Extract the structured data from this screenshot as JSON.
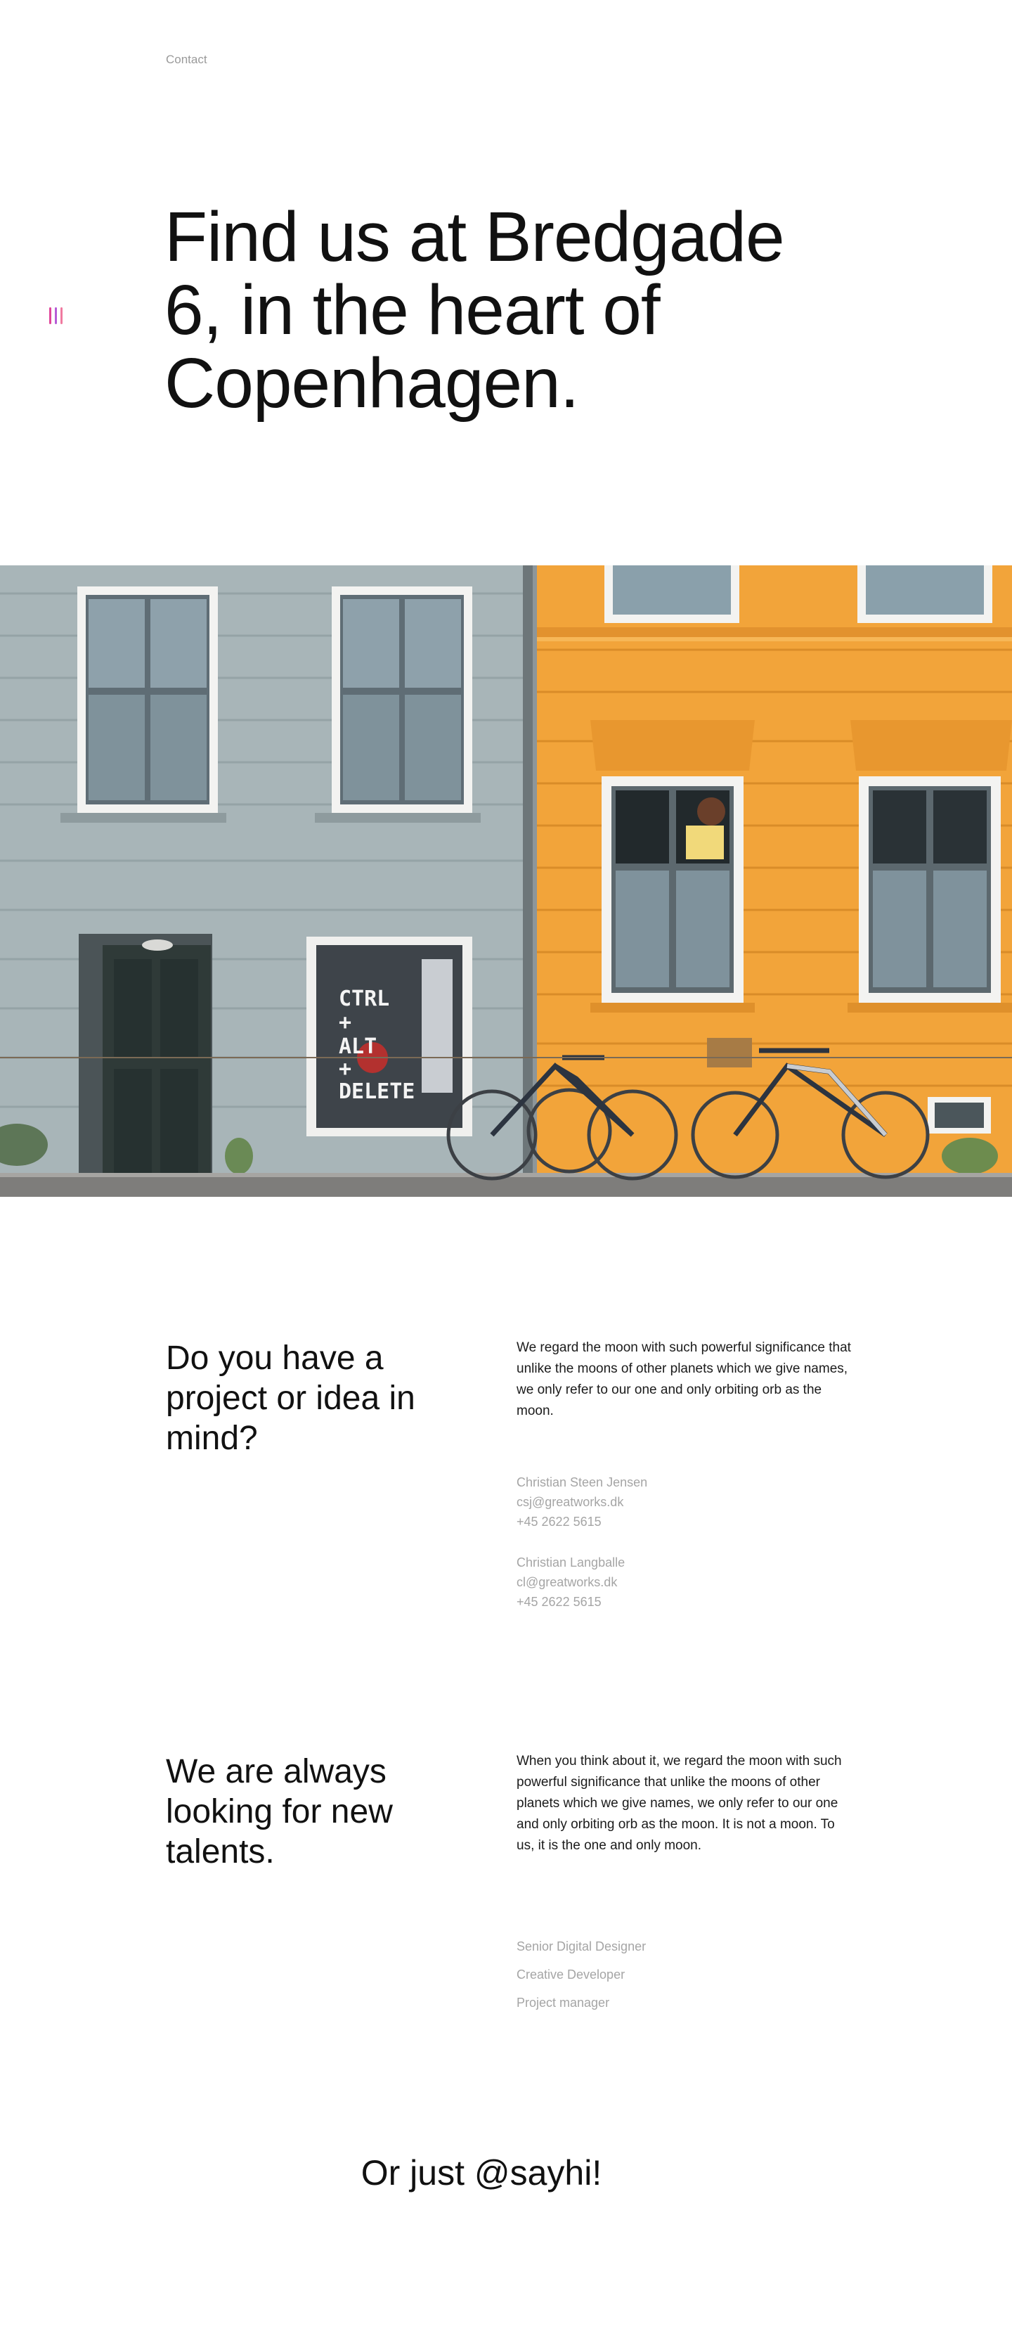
{
  "nav": {
    "contact_label": "Contact"
  },
  "menu_icon": {
    "colors": [
      "#e0459b",
      "#b65bd6",
      "#f07aa0"
    ]
  },
  "hero": {
    "title": "Find us at Bredgade 6, in the heart of Copenhagen."
  },
  "photo": {
    "storefront_text": [
      "CTRL",
      "+",
      "ALT",
      "+",
      "DELETE"
    ],
    "colors": {
      "grey_facade": "#a9b6b9",
      "orange_facade": "#f1a23a",
      "sidewalk": "#7e7d7b"
    }
  },
  "project": {
    "heading": "Do you have a project or idea in mind?",
    "body": "We regard the moon with such powerful significance that unlike the moons of other planets which we give names, we only refer to our one and only orbiting orb as the moon.",
    "contacts": [
      {
        "name": "Christian Steen Jensen",
        "email": "csj@greatworks.dk",
        "phone": "+45 2622 5615"
      },
      {
        "name": "Christian Langballe",
        "email": "cl@greatworks.dk",
        "phone": "+45 2622 5615"
      }
    ]
  },
  "careers": {
    "heading": "We are always looking for new talents.",
    "body": "When you think about it, we regard the moon with such powerful significance that unlike the moons of other planets which we give names, we only refer to our one and only orbiting orb as the moon. It is not a moon. To us, it is the one and only moon.",
    "jobs": [
      "Senior Digital Designer",
      "Creative Developer",
      "Project manager"
    ]
  },
  "footer": {
    "sayhi": "Or just @sayhi!"
  }
}
